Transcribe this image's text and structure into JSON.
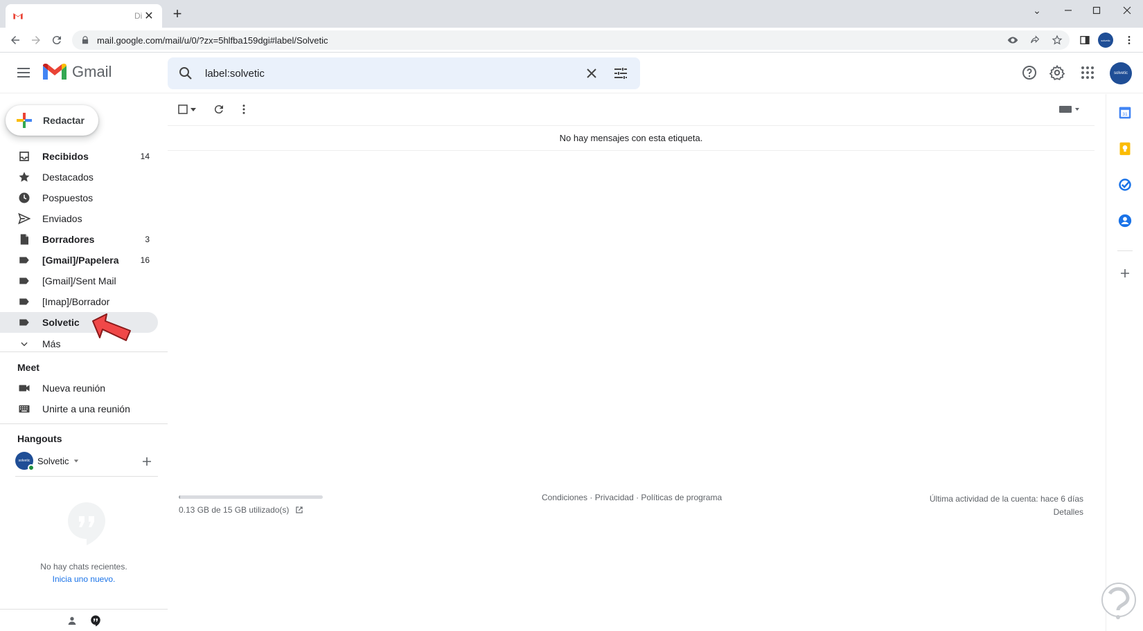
{
  "browser": {
    "tab_title": "Di",
    "url": "mail.google.com/mail/u/0/?zx=5hlfba159dgi#label/Solvetic",
    "avatar_text": "solvetic"
  },
  "header": {
    "app_name": "Gmail",
    "search_value": "label:solvetic",
    "avatar_text": "solvetic"
  },
  "sidebar": {
    "compose_label": "Redactar",
    "items": [
      {
        "label": "Recibidos",
        "count": "14"
      },
      {
        "label": "Destacados",
        "count": ""
      },
      {
        "label": "Pospuestos",
        "count": ""
      },
      {
        "label": "Enviados",
        "count": ""
      },
      {
        "label": "Borradores",
        "count": "3"
      },
      {
        "label": "[Gmail]/Papelera",
        "count": "16"
      },
      {
        "label": "[Gmail]/Sent Mail",
        "count": ""
      },
      {
        "label": "[Imap]/Borrador",
        "count": ""
      },
      {
        "label": "Solvetic",
        "count": ""
      },
      {
        "label": "Más",
        "count": ""
      }
    ],
    "meet": {
      "title": "Meet",
      "new_meeting": "Nueva reunión",
      "join_meeting": "Unirte a una reunión"
    },
    "hangouts": {
      "title": "Hangouts",
      "user_name": "Solvetic",
      "avatar_text": "solvetic",
      "no_chats": "No hay chats recientes.",
      "start_new": "Inicia uno nuevo."
    }
  },
  "main": {
    "empty_message": "No hay mensajes con esta etiqueta.",
    "storage_text": "0.13 GB de 15 GB utilizado(s)",
    "storage_fraction": 0.0087,
    "footer_links": [
      "Condiciones",
      "Privacidad",
      "Políticas de programa"
    ],
    "footer_sep": " · ",
    "activity": "Última actividad de la cuenta: hace 6 días",
    "details": "Detalles"
  },
  "sidepanel": {
    "calendar_day": "31"
  },
  "colors": {
    "accent_blue": "#1a73e8",
    "gmail_red": "#ea4335",
    "calendar_blue": "#4285f4",
    "keep_yellow": "#fbbc04",
    "tasks_blue": "#1a73e8",
    "arrow_red": "#f04848"
  }
}
